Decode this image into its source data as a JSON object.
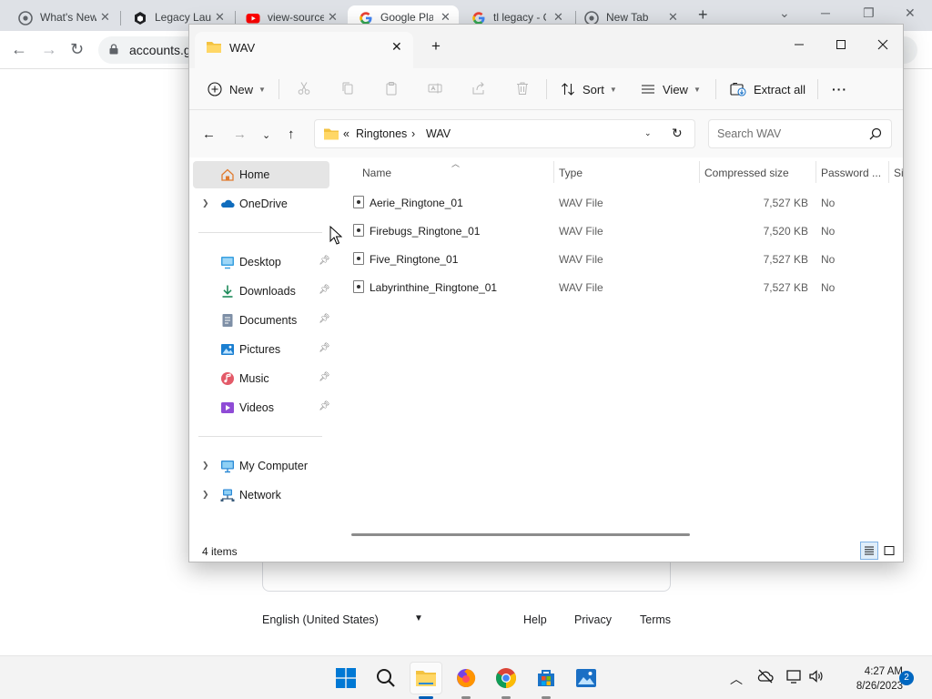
{
  "browser": {
    "tabs": [
      {
        "label": "What's New",
        "icon": "chrome-icon"
      },
      {
        "label": "Legacy Launcher",
        "icon": "legacy-launcher-icon"
      },
      {
        "label": "view-source",
        "icon": "youtube-icon"
      },
      {
        "label": "Google Play",
        "icon": "google-icon"
      },
      {
        "label": "tl legacy - Google",
        "icon": "google-icon"
      },
      {
        "label": "New Tab",
        "icon": "chrome-icon"
      }
    ],
    "omnibox_text": "accounts.g",
    "footer": {
      "language": "English (United States)",
      "links": [
        "Help",
        "Privacy",
        "Terms"
      ]
    }
  },
  "explorer": {
    "tab_title": "WAV",
    "commands": {
      "new": "New",
      "sort": "Sort",
      "view": "View",
      "extract_all": "Extract all",
      "more": "···"
    },
    "address": {
      "overflow": "«",
      "segments": [
        "Ringtones",
        "WAV"
      ],
      "separator": "›"
    },
    "search_placeholder": "Search WAV",
    "sidebar": {
      "home": "Home",
      "onedrive": "OneDrive",
      "quick_access": [
        {
          "label": "Desktop",
          "icon": "desktop-icon"
        },
        {
          "label": "Downloads",
          "icon": "downloads-icon"
        },
        {
          "label": "Documents",
          "icon": "documents-icon"
        },
        {
          "label": "Pictures",
          "icon": "pictures-icon"
        },
        {
          "label": "Music",
          "icon": "music-icon"
        },
        {
          "label": "Videos",
          "icon": "videos-icon"
        }
      ],
      "my_computer": "My Computer",
      "network": "Network"
    },
    "columns": [
      "Name",
      "Type",
      "Compressed size",
      "Password ...",
      "Si"
    ],
    "files": [
      {
        "name": "Aerie_Ringtone_01",
        "type": "WAV File",
        "size": "7,527 KB",
        "password": "No"
      },
      {
        "name": "Firebugs_Ringtone_01",
        "type": "WAV File",
        "size": "7,520 KB",
        "password": "No"
      },
      {
        "name": "Five_Ringtone_01",
        "type": "WAV File",
        "size": "7,527 KB",
        "password": "No"
      },
      {
        "name": "Labyrinthine_Ringtone_01",
        "type": "WAV File",
        "size": "7,527 KB",
        "password": "No"
      }
    ],
    "status": "4 items"
  },
  "taskbar": {
    "time": "4:27 AM",
    "date": "8/26/2023",
    "notifications": "2"
  },
  "colors": {
    "accent": "#005fb8",
    "folder": "#f3c240",
    "taskbar_bg": "#f3f3f3"
  }
}
